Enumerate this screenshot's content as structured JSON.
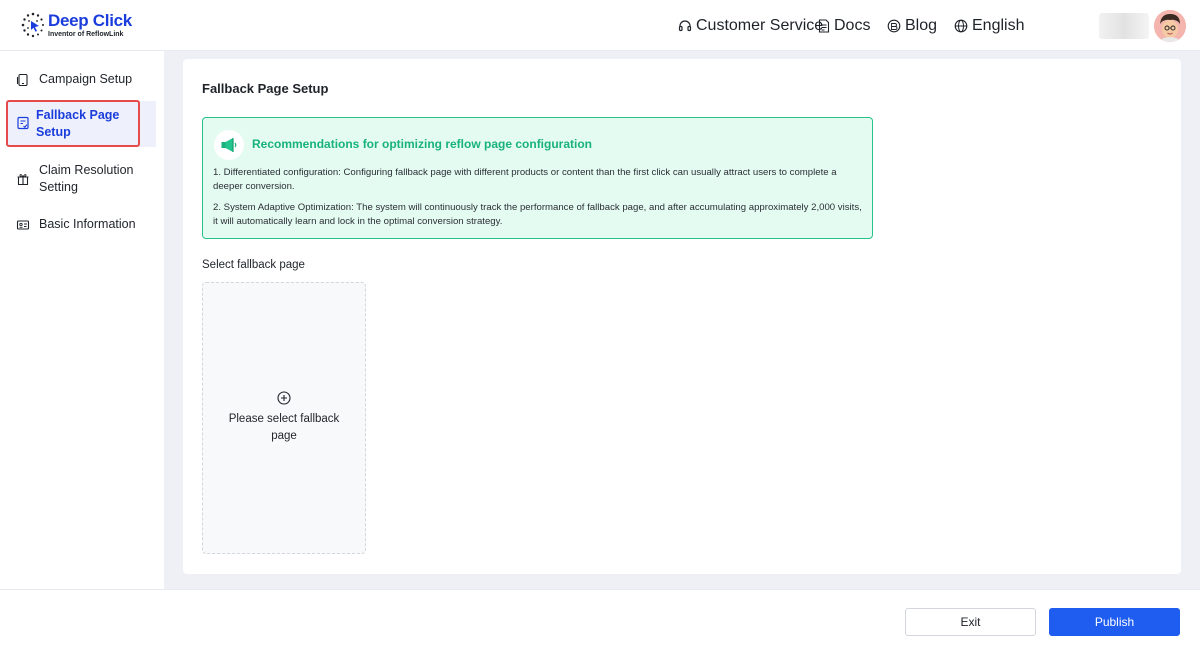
{
  "brand": {
    "name": "Deep Click",
    "tagline": "Inventor of ReflowLink"
  },
  "nav": {
    "customer_service": "Customer Service",
    "docs": "Docs",
    "blog": "Blog",
    "language": "English"
  },
  "sidebar": {
    "items": [
      {
        "label": "Campaign Setup",
        "icon": "phone-icon"
      },
      {
        "label": "Fallback Page Setup",
        "icon": "page-setup-icon",
        "active": true
      },
      {
        "label": "Claim Resolution Setting",
        "icon": "gift-icon"
      },
      {
        "label": "Basic Information",
        "icon": "id-card-icon"
      }
    ]
  },
  "main": {
    "title": "Fallback Page Setup",
    "tip": {
      "title": "Recommendations for optimizing reflow page configuration",
      "line1": "1. Differentiated configuration: Configuring fallback page with different products or content than the first click can usually attract users to complete a deeper conversion.",
      "line2": "2. System Adaptive Optimization: The system will continuously track the performance of fallback page, and after accumulating approximately 2,000 visits, it will automatically learn and lock in the optimal conversion strategy."
    },
    "select_label": "Select fallback page",
    "select_placeholder": "Please select fallback page"
  },
  "footer": {
    "exit_label": "Exit",
    "publish_label": "Publish"
  },
  "colors": {
    "brand": "#1a3ddc",
    "tip_green": "#18b27c",
    "tip_bg": "#e4fbf1",
    "publish": "#1f5cf0",
    "highlight": "#e64a4a"
  }
}
